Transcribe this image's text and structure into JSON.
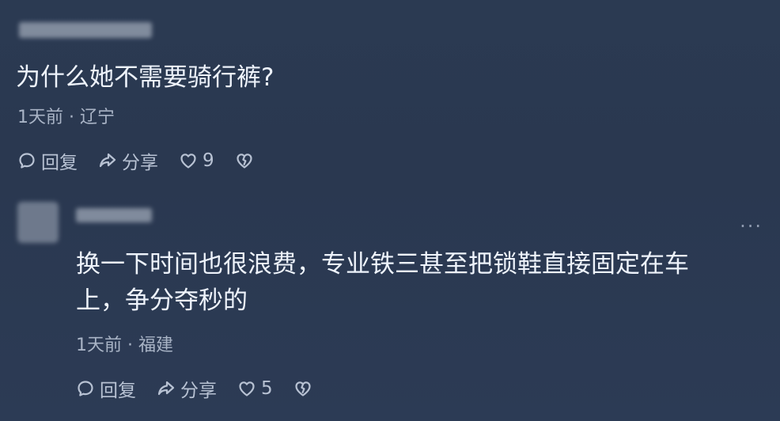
{
  "comment1": {
    "text": "为什么她不需要骑行裤?",
    "meta": "1天前 · 辽宁",
    "actions": {
      "reply_label": "回复",
      "share_label": "分享",
      "like_count": "9"
    }
  },
  "comment2": {
    "text_line1": "换一下时间也很浪费，专业铁三甚至把锁鞋直接固定在车",
    "text_line2": "上，争分夺秒的",
    "meta": "1天前 · 福建",
    "actions": {
      "reply_label": "回复",
      "share_label": "分享",
      "like_count": "5"
    },
    "more_label": "···"
  },
  "icons": [
    "reply-icon",
    "share-icon",
    "like-icon",
    "dislike-icon",
    "more-icon"
  ]
}
